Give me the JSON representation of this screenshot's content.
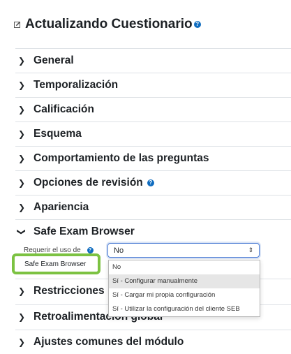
{
  "page": {
    "title": "Actualizando Cuestionario",
    "title_icon": "edit-icon",
    "help_icon": "question-circle-icon"
  },
  "sections": [
    {
      "label": "General",
      "expanded": false,
      "help": false
    },
    {
      "label": "Temporalización",
      "expanded": false,
      "help": false
    },
    {
      "label": "Calificación",
      "expanded": false,
      "help": false
    },
    {
      "label": "Esquema",
      "expanded": false,
      "help": false
    },
    {
      "label": "Comportamiento de las preguntas",
      "expanded": false,
      "help": false
    },
    {
      "label": "Opciones de revisión",
      "expanded": false,
      "help": true
    },
    {
      "label": "Apariencia",
      "expanded": false,
      "help": false
    },
    {
      "label": "Safe Exam Browser",
      "expanded": true,
      "help": false
    },
    {
      "label": "Restricciones",
      "expanded": false,
      "help": false
    },
    {
      "label": "Retroalimentación global",
      "expanded": false,
      "help": false
    },
    {
      "label": "Ajustes comunes del módulo",
      "expanded": false,
      "help": false
    }
  ],
  "seb": {
    "field_label": "Requerir el uso de",
    "highlight_label": "Safe Exam Browser",
    "select_value": "No",
    "options": [
      "No",
      "Sí - Configurar manualmente",
      "Sí - Cargar mi propia configuración",
      "Sí - Utilizar la configuración del cliente SEB"
    ],
    "highlighted_option_index": 1
  },
  "colors": {
    "help": "#0f6cbf",
    "highlight_border": "#7cc242",
    "select_focus": "#4a7bd4"
  }
}
